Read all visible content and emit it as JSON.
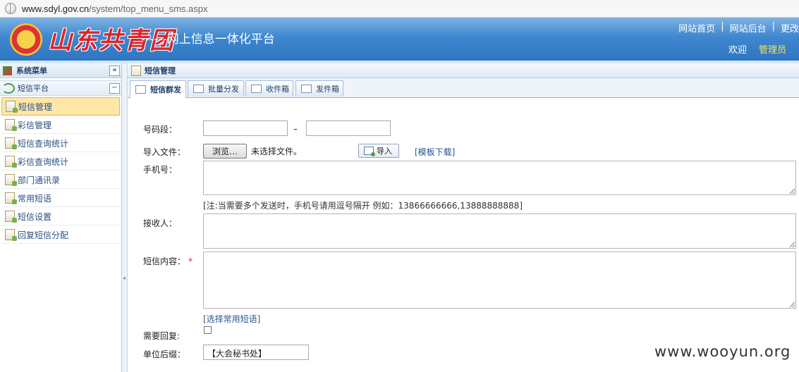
{
  "address_bar": {
    "domain": "www.sdyl.gov.cn",
    "path": "/system/top_menu_sms.aspx"
  },
  "header": {
    "logo_text": "山东共青团",
    "platform_title": "------网上信息一体化平台",
    "top_links": [
      "网站首页",
      "|",
      "网站后台",
      "|",
      "更改"
    ],
    "welcome": "欢迎",
    "user": "管理员"
  },
  "sidebar": {
    "title": "系统菜单",
    "collapse_symbol": "«",
    "group": "短信平台",
    "group_toggle": "−",
    "items": [
      "短信管理",
      "彩信管理",
      "短信查询统计",
      "彩信查询统计",
      "部门通讯录",
      "常用短语",
      "短信设置",
      "回复短信分配"
    ],
    "selected_index": 0
  },
  "main": {
    "title": "短信管理",
    "tabs": [
      "短信群发",
      "批量分发",
      "收件箱",
      "发件箱"
    ],
    "active_tab": 0
  },
  "form": {
    "number_range_label": "号码段：",
    "range_separator": "–",
    "range_start": "",
    "range_end": "",
    "import_file_label": "导入文件：",
    "browse_label": "浏览…",
    "no_file_text": "未选择文件。",
    "import_button": "导入",
    "template_link": "[模板下载]",
    "phone_label": "手机号：",
    "phone_note": "[注:当需要多个发送时，手机号请用逗号隔开 例如：13866666666,13888888888]",
    "receiver_label": "接收人：",
    "content_label": "短信内容：",
    "required_mark": "*",
    "common_phrase_link": "[选择常用短语]",
    "reply_label": "需要回复:",
    "reply_checked": false,
    "suffix_label": "单位后缀：",
    "suffix_value": "【大会秘书处】"
  },
  "watermark": "www.wooyun.org"
}
